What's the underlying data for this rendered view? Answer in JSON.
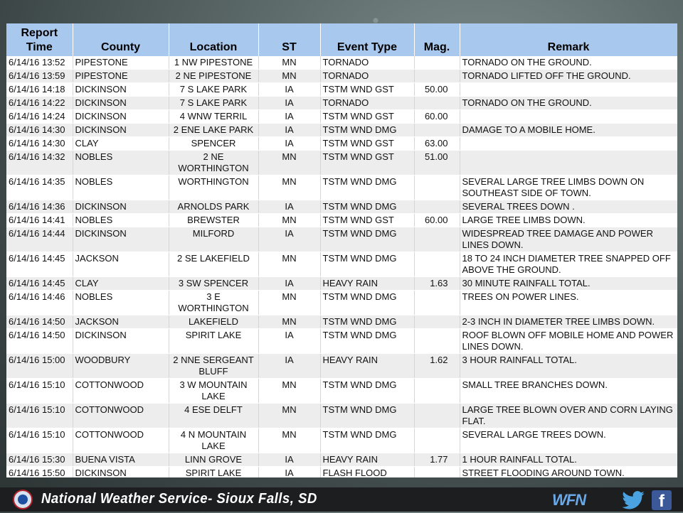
{
  "columns": [
    "Report Time",
    "County",
    "Location",
    "ST",
    "Event Type",
    "Mag.",
    "Remark"
  ],
  "rows": [
    {
      "time": "6/14/16 13:52",
      "county": "PIPESTONE",
      "location": "1 NW PIPESTONE",
      "st": "MN",
      "event": "TORNADO",
      "mag": "",
      "remark": "TORNADO ON THE GROUND."
    },
    {
      "time": "6/14/16 13:59",
      "county": "PIPESTONE",
      "location": "2 NE PIPESTONE",
      "st": "MN",
      "event": "TORNADO",
      "mag": "",
      "remark": "TORNADO LIFTED OFF THE GROUND."
    },
    {
      "time": "6/14/16 14:18",
      "county": "DICKINSON",
      "location": "7 S LAKE PARK",
      "st": "IA",
      "event": "TSTM WND GST",
      "mag": "50.00",
      "remark": ""
    },
    {
      "time": "6/14/16 14:22",
      "county": "DICKINSON",
      "location": "7 S LAKE PARK",
      "st": "IA",
      "event": "TORNADO",
      "mag": "",
      "remark": "TORNADO ON THE GROUND."
    },
    {
      "time": "6/14/16 14:24",
      "county": "DICKINSON",
      "location": "4 WNW TERRIL",
      "st": "IA",
      "event": "TSTM WND GST",
      "mag": "60.00",
      "remark": ""
    },
    {
      "time": "6/14/16 14:30",
      "county": "DICKINSON",
      "location": "2 ENE LAKE PARK",
      "st": "IA",
      "event": "TSTM WND DMG",
      "mag": "",
      "remark": "DAMAGE TO A MOBILE HOME."
    },
    {
      "time": "6/14/16 14:30",
      "county": "CLAY",
      "location": "SPENCER",
      "st": "IA",
      "event": "TSTM WND GST",
      "mag": "63.00",
      "remark": ""
    },
    {
      "time": "6/14/16 14:32",
      "county": "NOBLES",
      "location": "2 NE WORTHINGTON",
      "st": "MN",
      "event": "TSTM WND GST",
      "mag": "51.00",
      "remark": ""
    },
    {
      "time": "6/14/16 14:35",
      "county": "NOBLES",
      "location": "WORTHINGTON",
      "st": "MN",
      "event": "TSTM WND DMG",
      "mag": "",
      "remark": "SEVERAL LARGE TREE LIMBS DOWN ON SOUTHEAST SIDE OF TOWN."
    },
    {
      "time": "6/14/16 14:36",
      "county": "DICKINSON",
      "location": "ARNOLDS PARK",
      "st": "IA",
      "event": "TSTM WND DMG",
      "mag": "",
      "remark": "SEVERAL TREES DOWN ."
    },
    {
      "time": "6/14/16 14:41",
      "county": "NOBLES",
      "location": "BREWSTER",
      "st": "MN",
      "event": "TSTM WND GST",
      "mag": "60.00",
      "remark": "LARGE TREE LIMBS DOWN."
    },
    {
      "time": "6/14/16 14:44",
      "county": "DICKINSON",
      "location": "MILFORD",
      "st": "IA",
      "event": "TSTM WND DMG",
      "mag": "",
      "remark": "WIDESPREAD TREE DAMAGE AND POWER LINES DOWN."
    },
    {
      "time": "6/14/16 14:45",
      "county": "JACKSON",
      "location": "2 SE LAKEFIELD",
      "st": "MN",
      "event": "TSTM WND DMG",
      "mag": "",
      "remark": "18 TO 24 INCH DIAMETER TREE SNAPPED OFF ABOVE THE GROUND."
    },
    {
      "time": "6/14/16 14:45",
      "county": "CLAY",
      "location": "3 SW SPENCER",
      "st": "IA",
      "event": "HEAVY RAIN",
      "mag": "1.63",
      "remark": "30 MINUTE RAINFALL TOTAL."
    },
    {
      "time": "6/14/16 14:46",
      "county": "NOBLES",
      "location": "3 E WORTHINGTON",
      "st": "MN",
      "event": "TSTM WND DMG",
      "mag": "",
      "remark": "TREES ON POWER LINES."
    },
    {
      "time": "6/14/16 14:50",
      "county": "JACKSON",
      "location": "LAKEFIELD",
      "st": "MN",
      "event": "TSTM WND DMG",
      "mag": "",
      "remark": "2-3 INCH IN DIAMETER TREE LIMBS DOWN."
    },
    {
      "time": "6/14/16 14:50",
      "county": "DICKINSON",
      "location": "SPIRIT LAKE",
      "st": "IA",
      "event": "TSTM WND DMG",
      "mag": "",
      "remark": "ROOF BLOWN OFF MOBILE HOME AND POWER LINES DOWN."
    },
    {
      "time": "6/14/16 15:00",
      "county": "WOODBURY",
      "location": "2 NNE SERGEANT BLUFF",
      "st": "IA",
      "event": "HEAVY RAIN",
      "mag": "1.62",
      "remark": "3 HOUR RAINFALL TOTAL."
    },
    {
      "time": "6/14/16 15:10",
      "county": "COTTONWOOD",
      "location": "3 W MOUNTAIN LAKE",
      "st": "MN",
      "event": "TSTM WND DMG",
      "mag": "",
      "remark": "SMALL TREE BRANCHES DOWN."
    },
    {
      "time": "6/14/16 15:10",
      "county": "COTTONWOOD",
      "location": "4 ESE DELFT",
      "st": "MN",
      "event": "TSTM WND DMG",
      "mag": "",
      "remark": "LARGE TREE BLOWN OVER AND CORN LAYING FLAT."
    },
    {
      "time": "6/14/16 15:10",
      "county": "COTTONWOOD",
      "location": "4 N MOUNTAIN LAKE",
      "st": "MN",
      "event": "TSTM WND DMG",
      "mag": "",
      "remark": "SEVERAL LARGE TREES DOWN."
    },
    {
      "time": "6/14/16 15:30",
      "county": "BUENA VISTA",
      "location": "LINN GROVE",
      "st": "IA",
      "event": "HEAVY RAIN",
      "mag": "1.77",
      "remark": "1 HOUR RAINFALL TOTAL."
    },
    {
      "time": "6/14/16 15:50",
      "county": "DICKINSON",
      "location": "SPIRIT LAKE",
      "st": "IA",
      "event": "FLASH FLOOD",
      "mag": "",
      "remark": "STREET FLOODING AROUND TOWN."
    }
  ],
  "footer": {
    "title": "National Weather Service- Sioux Falls, SD",
    "logo_icon": "nws-logo-icon",
    "wfn_label": "WFN",
    "social_icons": [
      "twitter-icon",
      "facebook-icon"
    ]
  },
  "colors": {
    "header_bg": "#a9c8ee",
    "footer_bg": "#1c1e20",
    "facebook": "#3b5998"
  }
}
